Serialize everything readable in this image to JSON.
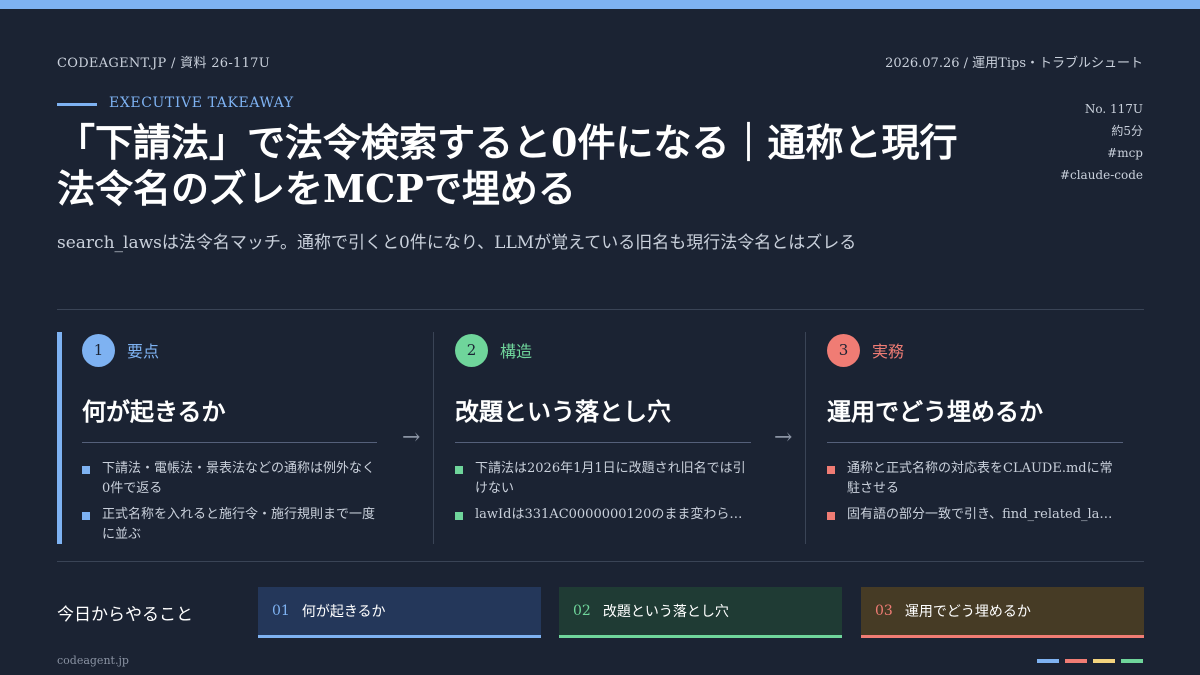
{
  "header": {
    "site": "CODEAGENT.JP",
    "doc_id": "資料 26-117U",
    "date": "2026.07.26",
    "category": "運用Tips・トラブルシュート",
    "sep": "/"
  },
  "kicker": "EXECUTIVE TAKEAWAY",
  "side_meta": {
    "number": "No. 117U",
    "reading_time": "約5分",
    "tag1": "#mcp",
    "tag2": "#claude-code"
  },
  "title": "「下請法」で法令検索すると0件になる｜通称と現行法令名のズレをMCPで埋める",
  "subtitle": "search_lawsは法令名マッチ。通称で引くと0件になり、LLMが覚えている旧名も現行法令名とはズレる",
  "columns": [
    {
      "number": "1",
      "label": "要点",
      "heading": "何が起きるか",
      "bullets": [
        "下請法・電帳法・景表法などの通称は例外なく0件で返る",
        "正式名称を入れると施行令・施行規則まで一度に並ぶ"
      ]
    },
    {
      "number": "2",
      "label": "構造",
      "heading": "改題という落とし穴",
      "bullets": [
        "下請法は2026年1月1日に改題され旧名では引けない",
        "lawIdは331AC0000000120のまま変わら…"
      ]
    },
    {
      "number": "3",
      "label": "実務",
      "heading": "運用でどう埋めるか",
      "bullets": [
        "通称と正式名称の対応表をCLAUDE.mdに常駐させる",
        "固有語の部分一致で引き、find_related_la…"
      ]
    }
  ],
  "arrow": "→",
  "todo": {
    "label": "今日からやること",
    "items": [
      {
        "num": "01",
        "text": "何が起きるか"
      },
      {
        "num": "02",
        "text": "改題という落とし穴"
      },
      {
        "num": "03",
        "text": "運用でどう埋めるか"
      }
    ]
  },
  "footer": {
    "site": "codeagent.jp"
  },
  "colors": {
    "blue": "#7eb2f2",
    "green": "#6fd59b",
    "red": "#f07c74",
    "yellow": "#f2d37e",
    "bg": "#1b2333"
  }
}
